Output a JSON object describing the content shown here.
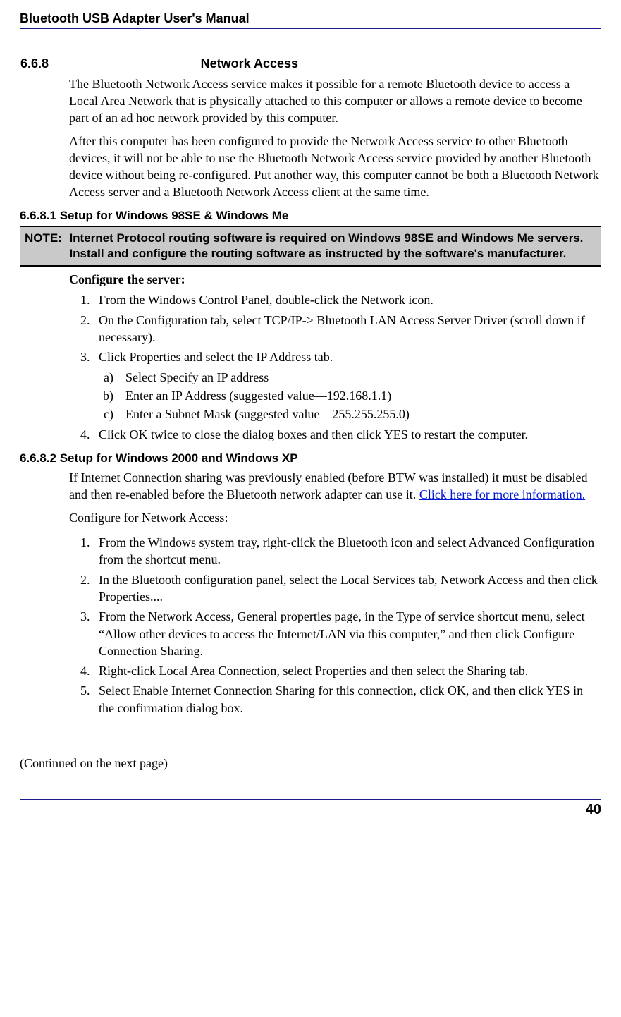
{
  "header": {
    "title": "Bluetooth USB Adapter User's Manual"
  },
  "section668": {
    "num": "6.6.8",
    "title": "Network Access",
    "para1": "The Bluetooth Network Access service makes it possible for a remote Bluetooth device to access a Local Area Network that is physically attached to this computer or allows a remote device to become part of an ad hoc network provided by this computer.",
    "para2": "After this computer has been configured to provide the Network Access service to other Bluetooth devices, it will not be able to use the Bluetooth Network Access service provided by another Bluetooth device without being re-configured. Put another way, this computer cannot be both a Bluetooth Network Access server and a Bluetooth Network Access client at the same time."
  },
  "section6681": {
    "heading": "6.6.8.1  Setup for Windows 98SE & Windows Me",
    "note_label": "NOTE:",
    "note_line1": "Internet Protocol routing software is required on Windows 98SE and Windows Me servers.",
    "note_line2": "Install and configure the routing software as instructed by the software's manufacturer.",
    "configure_label": "Configure the server:",
    "steps": {
      "s1": "From the Windows Control Panel, double-click the Network icon.",
      "s2": "On the Configuration tab, select TCP/IP-> Bluetooth LAN Access Server Driver (scroll down if necessary).",
      "s3": "Click Properties and select the IP Address tab.",
      "s3a": "Select Specify an IP address",
      "s3b": "Enter an IP Address (suggested value—192.168.1.1)",
      "s3c": "Enter a Subnet Mask (suggested value—255.255.255.0)",
      "s4": "Click OK twice to close the dialog boxes and then click YES to restart the computer."
    }
  },
  "section6682": {
    "heading": "6.6.8.2  Setup for Windows 2000 and Windows XP",
    "para_pre": "If Internet Connection sharing was previously enabled (before BTW was installed) it must be disabled and then re-enabled before the Bluetooth network adapter can use it. ",
    "link_text": "Click here for more information.",
    "configure_label": "Configure for Network Access:",
    "steps": {
      "s1": "From the Windows system tray, right-click the Bluetooth icon and select Advanced Configuration from the shortcut menu.",
      "s2": "In the Bluetooth configuration panel, select the Local Services tab, Network Access and then click Properties....",
      "s3": "From the Network Access, General properties page, in the Type of service shortcut menu, select “Allow other devices to access the Internet/LAN via this computer,” and then click Configure Connection Sharing.",
      "s4": "Right-click Local Area Connection, select Properties and then select the Sharing tab.",
      "s5": "Select Enable Internet Connection Sharing for this connection, click OK, and then click YES in the confirmation dialog box."
    }
  },
  "continued": "(Continued on the next page)",
  "footer": {
    "page": "40"
  }
}
